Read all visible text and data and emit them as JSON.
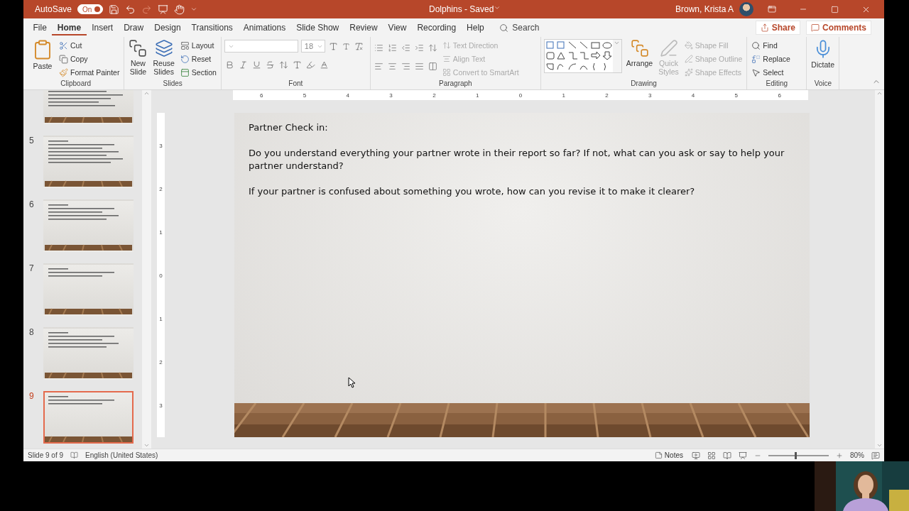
{
  "window": {
    "autosave_label": "AutoSave",
    "autosave": {
      "label": "On",
      "on": true
    },
    "title": "Dolphins  -  Saved",
    "user": "Brown, Krista A"
  },
  "menu_tabs": [
    {
      "label": "File",
      "selected": false
    },
    {
      "label": "Home",
      "selected": true
    },
    {
      "label": "Insert",
      "selected": false
    },
    {
      "label": "Draw",
      "selected": false
    },
    {
      "label": "Design",
      "selected": false
    },
    {
      "label": "Transitions",
      "selected": false
    },
    {
      "label": "Animations",
      "selected": false
    },
    {
      "label": "Slide Show",
      "selected": false
    },
    {
      "label": "Review",
      "selected": false
    },
    {
      "label": "View",
      "selected": false
    },
    {
      "label": "Recording",
      "selected": false
    },
    {
      "label": "Help",
      "selected": false
    }
  ],
  "search": {
    "placeholder": "Search"
  },
  "share": "Share",
  "comments": "Comments",
  "ribbon": {
    "clipboard": {
      "label": "Clipboard",
      "paste": "Paste",
      "cut": "Cut",
      "copy": "Copy",
      "format_painter": "Format Painter"
    },
    "slides": {
      "label": "Slides",
      "new_slide": [
        "New",
        "Slide"
      ],
      "reuse_slides": [
        "Reuse",
        "Slides"
      ],
      "layout": "Layout",
      "reset": "Reset",
      "section": "Section"
    },
    "font": {
      "label": "Font",
      "size": "18"
    },
    "paragraph": {
      "label": "Paragraph",
      "commands": [
        {
          "label": "Text Direction",
          "disabled": true
        },
        {
          "label": "Align Text",
          "disabled": true
        },
        {
          "label": "Convert to SmartArt",
          "disabled": true
        }
      ]
    },
    "drawing": {
      "label": "Drawing",
      "arrange": "Arrange",
      "quick_styles": {
        "label": [
          "Quick",
          "Styles"
        ],
        "disabled": true
      },
      "commands": [
        {
          "label": "Shape Fill",
          "disabled": true
        },
        {
          "label": "Shape Outline",
          "disabled": true
        },
        {
          "label": "Shape Effects",
          "disabled": true
        }
      ]
    },
    "editing": {
      "label": "Editing",
      "find": "Find",
      "replace": "Replace",
      "select": "Select"
    },
    "voice": {
      "label": "Voice",
      "dictate": "Dictate"
    }
  },
  "thumbnails": [
    {
      "number": "5",
      "selected": false
    },
    {
      "number": "6",
      "selected": false
    },
    {
      "number": "7",
      "selected": false
    },
    {
      "number": "8",
      "selected": false
    },
    {
      "number": "9",
      "selected": true
    }
  ],
  "ruler": {
    "horizontal": [
      "6",
      "5",
      "4",
      "3",
      "2",
      "1",
      "0",
      "1",
      "2",
      "3",
      "4",
      "5",
      "6"
    ],
    "vertical": [
      "3",
      "2",
      "1",
      "0",
      "1",
      "2",
      "3"
    ]
  },
  "slide": {
    "title": "Partner Check in:",
    "paragraphs": [
      "Do you understand everything your partner wrote in their report so far? If not, what can you ask or say to help your partner understand?",
      "If your partner is confused about something you wrote, how can you revise it to make it clearer?"
    ]
  },
  "status_bar": {
    "slide": "Slide 9 of 9",
    "language": "English (United States)",
    "notes": "Notes",
    "zoom": {
      "level": 0.45
    },
    "zoom_label": "80%"
  }
}
